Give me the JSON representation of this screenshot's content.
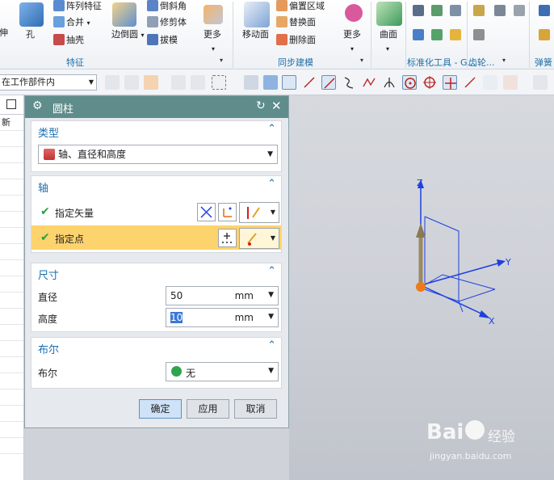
{
  "ribbon": {
    "extrude_partial": "伸",
    "hole": "孔",
    "pattern_feature": "阵列特征",
    "unite": "合并",
    "shell": "抽壳",
    "edge_blend": "边倒圆",
    "chamfer": "倒斜角",
    "trim_body": "修剪体",
    "draft": "拔模",
    "more1": "更多",
    "group_feature": "特征",
    "move_face": "移动面",
    "offset_region": "偏置区域",
    "replace_face": "替换面",
    "delete_face": "删除面",
    "more2": "更多",
    "group_sync": "同步建模",
    "surface": "曲面",
    "group_standard": "标准化工具 - G...",
    "group_gear": "齿轮...",
    "group_spring": "弹簧"
  },
  "toolbar": {
    "scope": "在工作部件内"
  },
  "leftpanel": {
    "header_text": "新"
  },
  "dialog": {
    "title": "圆柱",
    "type_section": "类型",
    "type_value": "轴、直径和高度",
    "axis_section": "轴",
    "specify_vector": "指定矢量",
    "specify_point": "指定点",
    "dims_section": "尺寸",
    "diameter_label": "直径",
    "diameter_value": "50",
    "diameter_unit": "mm",
    "height_label": "高度",
    "height_value": "10",
    "height_unit": "mm",
    "bool_section": "布尔",
    "bool_label": "布尔",
    "bool_value": "无",
    "ok": "确定",
    "apply": "应用",
    "cancel": "取消"
  },
  "viewport": {
    "axis_z": "Z",
    "axis_y": "Y",
    "axis_x": "X"
  },
  "watermark": {
    "brand": "Bai",
    "brand2": "经验",
    "url": "jingyan.baidu.com"
  },
  "colors": {
    "title_bar": "#5e8d8b",
    "section_title": "#1a6fb0",
    "highlight_row": "#fdd36e",
    "axis_blue": "#1f3fe0"
  }
}
